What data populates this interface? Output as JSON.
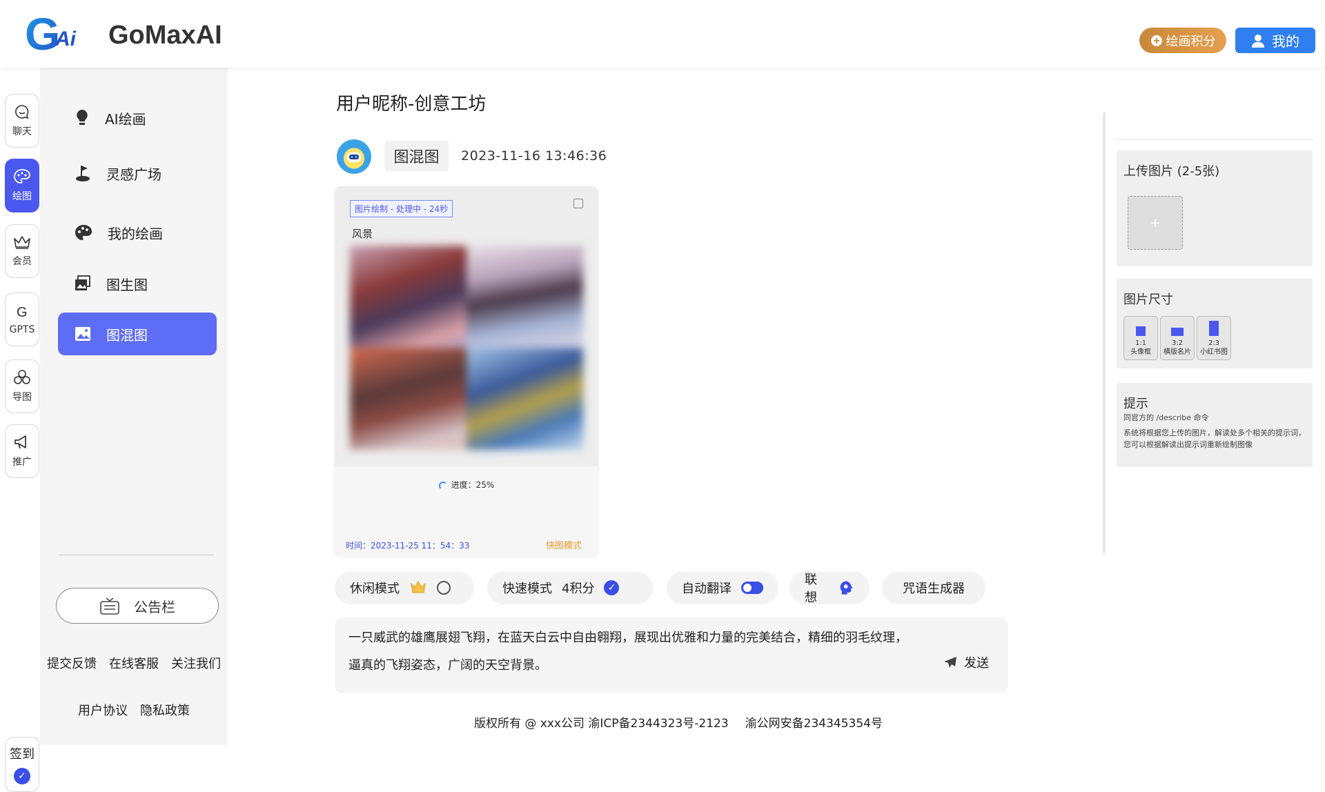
{
  "header": {
    "logo_text": "GoMaxAI",
    "logo_mark": "GAi",
    "points_button": "绘画积分",
    "mine_button": "我的"
  },
  "rail": {
    "items": [
      {
        "label": "聊天",
        "icon": "chat-bubble-icon"
      },
      {
        "label": "绘图",
        "icon": "palette-icon",
        "active": true
      },
      {
        "label": "会员",
        "icon": "crown-icon"
      },
      {
        "label": "GPTS",
        "icon": "g-letter-icon"
      },
      {
        "label": "导图",
        "icon": "mindmap-icon"
      },
      {
        "label": "推广",
        "icon": "megaphone-icon"
      }
    ],
    "checkin": "签到"
  },
  "sidebar": {
    "items": [
      {
        "label": "AI绘画",
        "icon": "lightbulb-icon"
      },
      {
        "label": "灵感广场",
        "icon": "golf-flag-icon"
      },
      {
        "label": "我的绘画",
        "icon": "palette-icon"
      },
      {
        "label": "图生图",
        "icon": "image-stack-icon"
      },
      {
        "label": "图混图",
        "icon": "image-icon",
        "active": true
      }
    ],
    "notice_button": "公告栏",
    "links_row1": [
      "提交反馈",
      "在线客服",
      "关注我们"
    ],
    "links_row2": [
      "用户协议",
      "隐私政策"
    ]
  },
  "main": {
    "title": "用户昵称-创意工坊",
    "tag": "图混图",
    "datetime": "2023-11-16  13:46:36",
    "card": {
      "status": "图片绘制 - 处理中 - 24秒",
      "prompt": "风景",
      "progress_label": "进度：25%",
      "progress": 0.25,
      "time": "时间：2023-11-25 11：54：33",
      "mode": "快图模式"
    },
    "options": {
      "relax_label": "休闲模式",
      "fast_label": "快速模式",
      "fast_cost": "4积分",
      "translate_label": "自动翻译",
      "assoc_label": "联想",
      "spell_label": "咒语生成器"
    },
    "prompt_line1": "一只威武的雄鹰展翅飞翔，在蓝天白云中自由翱翔，展现出优雅和力量的完美结合，精细的羽毛纹理，",
    "prompt_line2": "逼真的飞翔姿态，广阔的天空背景。",
    "send_label": "发送"
  },
  "footer": {
    "copyright": "版权所有 @ xxx公司 渝ICP备2344323号-2123",
    "police": "渝公网安备234345354号"
  },
  "right_panel": {
    "upload_title": "上传图片 (2-5张)",
    "upload_plus": "+",
    "size_title": "图片尺寸",
    "sizes": [
      {
        "ratio": "1:1",
        "name": "头像框"
      },
      {
        "ratio": "3:2",
        "name": "横版名片"
      },
      {
        "ratio": "2:3",
        "name": "小红书图"
      }
    ],
    "tip_title": "提示",
    "tip_line1": "同官方的 /describe 命令",
    "tip_line2": "系统将根据您上传的图片，解读处多个相关的提示词，您可以根据解读出提示词重新绘制图像"
  },
  "colors": {
    "accent": "#4b58ee",
    "active_menu": "#5e6df5",
    "points_button": "#d8903f",
    "mine_button": "#2f7ff0",
    "mode_orange": "#e8982e"
  }
}
